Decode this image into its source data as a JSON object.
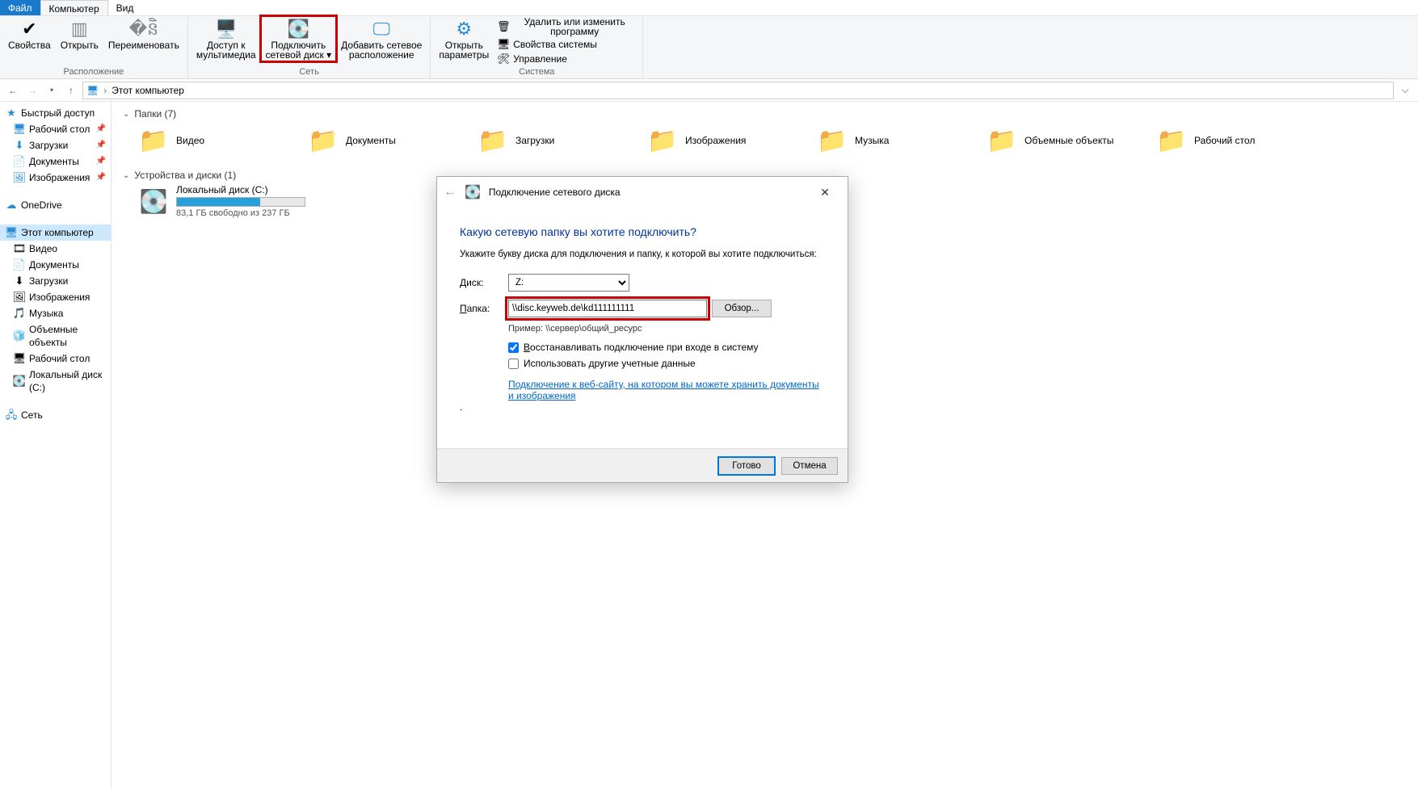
{
  "menubar": {
    "file": "Файл",
    "computer": "Компьютер",
    "view": "Вид"
  },
  "ribbon": {
    "location": {
      "caption": "Расположение",
      "properties": "Свойства",
      "open": "Открыть",
      "rename": "Переименовать"
    },
    "network": {
      "caption": "Сеть",
      "media": "Доступ к\nмультимедиа",
      "map": "Подключить\nсетевой диск ▾",
      "addloc": "Добавить сетевое\nрасположение"
    },
    "system": {
      "caption": "Система",
      "settings": "Открыть\nпараметры",
      "uninstall": "Удалить или изменить программу",
      "sysprops": "Свойства системы",
      "manage": "Управление"
    }
  },
  "address": {
    "path": "Этот компьютер"
  },
  "nav": {
    "quick": "Быстрый доступ",
    "desktop": "Рабочий стол",
    "downloads": "Загрузки",
    "documents": "Документы",
    "pictures": "Изображения",
    "onedrive": "OneDrive",
    "thispc": "Этот компьютер",
    "videos": "Видео",
    "documents2": "Документы",
    "downloads2": "Загрузки",
    "pictures2": "Изображения",
    "music": "Музыка",
    "objects3d": "Объемные объекты",
    "desktop2": "Рабочий стол",
    "localdisk": "Локальный диск (C:)",
    "network": "Сеть"
  },
  "main": {
    "folders_header": "Папки (7)",
    "folders": {
      "videos": "Видео",
      "documents": "Документы",
      "downloads": "Загрузки",
      "pictures": "Изображения",
      "music": "Музыка",
      "objects3d": "Объемные объекты",
      "desktop": "Рабочий стол"
    },
    "drives_header": "Устройства и диски (1)",
    "drive": {
      "name": "Локальный диск (C:)",
      "free": "83,1 ГБ свободно из 237 ГБ"
    }
  },
  "dialog": {
    "title": "Подключение сетевого диска",
    "heading": "Какую сетевую папку вы хотите подключить?",
    "subheading": "Укажите букву диска для подключения и папку, к которой вы хотите подключиться:",
    "drive_label": "Диск:",
    "drive_value": "Z:",
    "folder_label": "Папка:",
    "folder_value": "\\\\disc.keyweb.de\\kd111111111",
    "browse": "Обзор...",
    "example": "Пример: \\\\сервер\\общий_ресурс",
    "reconnect": "Восстанавливать подключение при входе в систему",
    "othercreds": "Использовать другие учетные данные",
    "link": "Подключение к веб-сайту, на котором вы можете хранить документы и изображения",
    "finish": "Готово",
    "cancel": "Отмена"
  }
}
